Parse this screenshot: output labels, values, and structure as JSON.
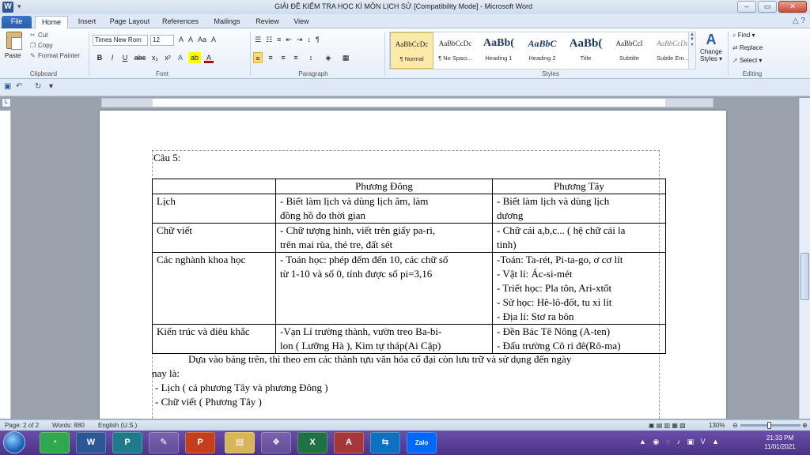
{
  "window": {
    "title": "GIẢI ĐỀ KIỂM TRA HỌC KÌ MÔN LỊCH SỬ [Compatibility Mode] - Microsoft Word",
    "app_icon": "W",
    "minimize": "–",
    "maximize": "▭",
    "close": "✕"
  },
  "ribbon_tabs": [
    "File",
    "Home",
    "Insert",
    "Page Layout",
    "References",
    "Mailings",
    "Review",
    "View"
  ],
  "clipboard": {
    "paste": "Paste",
    "cut": "Cut",
    "copy": "Copy",
    "format_painter": "Format Painter",
    "group": "Clipboard"
  },
  "font": {
    "name": "Times New Rom",
    "size": "12",
    "group": "Font",
    "grow": "A",
    "shrink": "A",
    "case": "Aa",
    "clear": "A",
    "bold": "B",
    "italic": "I",
    "underline": "U",
    "strike": "abc",
    "subscript": "x₂",
    "superscript": "x²",
    "effects": "A",
    "highlight": "ab",
    "color": "A"
  },
  "paragraph": {
    "group": "Paragraph",
    "bullets": "☰",
    "numbering": "☷",
    "multilevel": "≡",
    "decrease_indent": "⇤",
    "increase_indent": "⇥",
    "sort": "↕",
    "show_marks": "¶",
    "align_left": "≡",
    "center": "≡",
    "align_right": "≡",
    "justify": "≡",
    "line_spacing": "↕",
    "shading": "◈",
    "borders": "▦"
  },
  "styles": {
    "group": "Styles",
    "items": [
      {
        "sample": "AaBbCcDc",
        "name": "¶ Normal"
      },
      {
        "sample": "AaBbCcDc",
        "name": "¶ No Spaci..."
      },
      {
        "sample": "AaBb(",
        "name": "Heading 1"
      },
      {
        "sample": "AaBbC",
        "name": "Heading 2"
      },
      {
        "sample": "AaBb(",
        "name": "Title"
      },
      {
        "sample": "AaBbCcI",
        "name": "Subtitle"
      },
      {
        "sample": "AaBbCcDc",
        "name": "Subtle Em..."
      }
    ],
    "change_styles": "Change Styles ▾"
  },
  "editing": {
    "group": "Editing",
    "find": "Find ▾",
    "replace": "Replace",
    "select": "Select ▾"
  },
  "document": {
    "question": "Câu 5:",
    "table": {
      "headers": [
        "",
        "Phương Đông",
        "Phương Tây"
      ],
      "rows": [
        {
          "label": "Lịch",
          "east": [
            "- Biết làm lịch và dùng lịch âm, làm",
            "đồng hồ đo thời gian"
          ],
          "west": [
            "- Biết làm lịch và dùng lịch",
            "dương"
          ]
        },
        {
          "label": "Chữ viết",
          "east": [
            "- Chữ tượng hình, viết trên giấy pa-ri,",
            "trên mai rùa, thẻ tre, đất sét"
          ],
          "west": [
            "- Chữ cái a,b,c... ( hệ chữ cái la",
            "tinh)"
          ]
        },
        {
          "label": "Các nghành khoa học",
          "east": [
            "- Toán học: phép đếm đến 10, các chữ số",
            "từ 1-10 và số 0, tính được số pi=3,16"
          ],
          "west": [
            "-Toán: Ta-rét, Pi-ta-go, ơ cơ lít",
            "- Vật lí: Ác-si-mét",
            "- Triết học: Pla tôn, Ari-xtốt",
            "- Sử học: Hê-lô-đốt, tu xi lít",
            "- Địa lí: Stơ ra bôn"
          ]
        },
        {
          "label": "Kiến trúc và điêu khắc",
          "east": [
            "-Vạn Lí trường thành, vườn treo Ba-bi-",
            "lon ( Lưỡng Hà ), Kim tự tháp(Ai Cập)"
          ],
          "west": [
            "- Đền Bác Tê Nông (A-ten)",
            "- Đấu trường Cô ri đê(Rô-ma)"
          ]
        }
      ]
    },
    "para_line1": "Dựa vào bảng trên, thì theo em các thành tựu văn hóa cổ đại còn lưu trữ và sử dụng đến ngày",
    "para_line2": "nay là:",
    "bullet1": "- Lịch ( cả phương Tây và phương Đông )",
    "bullet2": "- Chữ viết ( Phương Tây )"
  },
  "status": {
    "page": "Page: 2 of 2",
    "words": "Words: 880",
    "language": "English (U.S.)",
    "zoom": "130%"
  },
  "taskbar": {
    "apps": [
      "Word",
      "Publisher",
      "PowerPoint",
      "Explorer",
      "Excel",
      "Access",
      "TeamViewer",
      "Zalo"
    ],
    "time": "21:33 PM",
    "date": "11/01/2021"
  }
}
